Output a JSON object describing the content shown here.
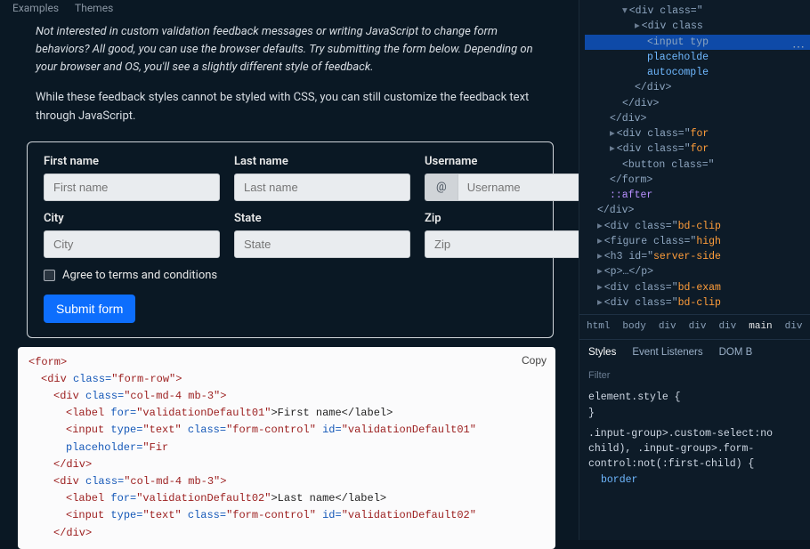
{
  "nav": {
    "examples": "Examples",
    "themes": "Themes"
  },
  "para1": "Not interested in custom validation feedback messages or writing JavaScript to change form behaviors? All good, you can use the browser defaults. Try submitting the form below. Depending on your browser and OS, you'll see a slightly different style of feedback.",
  "para2": "While these feedback styles cannot be styled with CSS, you can still customize the feedback text through JavaScript.",
  "form": {
    "first_label": "First name",
    "first_ph": "First name",
    "last_label": "Last name",
    "last_ph": "Last name",
    "user_label": "Username",
    "user_prefix": "@",
    "user_ph": "Username",
    "city_label": "City",
    "city_ph": "City",
    "state_label": "State",
    "state_ph": "State",
    "zip_label": "Zip",
    "zip_ph": "Zip",
    "terms": "Agree to terms and conditions",
    "submit": "Submit form"
  },
  "code": {
    "copy": "Copy",
    "l1a": "<form>",
    "l2a": "<div ",
    "l2b": "class=",
    "l2c": "\"form-row\"",
    "l2d": ">",
    "l3a": "<div ",
    "l3b": "class=",
    "l3c": "\"col-md-4 mb-3\"",
    "l3d": ">",
    "l4a": "<label ",
    "l4b": "for=",
    "l4c": "\"validationDefault01\"",
    "l4d": ">First name</label>",
    "l5a": "<input ",
    "l5b": "type=",
    "l5c": "\"text\"",
    "l5d": " class=",
    "l5e": "\"form-control\"",
    "l5f": " id=",
    "l5g": "\"validationDefault01\"",
    "l5h": " placeholder=",
    "l5i": "\"Fir",
    "l6a": "</div>",
    "l7a": "<div ",
    "l7b": "class=",
    "l7c": "\"col-md-4 mb-3\"",
    "l7d": ">",
    "l8a": "<label ",
    "l8b": "for=",
    "l8c": "\"validationDefault02\"",
    "l8d": ">Last name</label>",
    "l9a": "<input ",
    "l9b": "type=",
    "l9c": "\"text\"",
    "l9d": " class=",
    "l9e": "\"form-control\"",
    "l9f": " id=",
    "l9g": "\"validationDefault02\"",
    "l10a": "</div>"
  },
  "dom": {
    "d1": "<div class=\"",
    "d2": "<div class",
    "d3": "<input typ",
    "d4": "placeholde",
    "d5": "autocomple",
    "d6": "</div>",
    "d7": "</div>",
    "d8": "</div>",
    "d9a": "<div class=\"",
    "d9b": "for",
    "d10a": "<div class=\"",
    "d10b": "for",
    "d11a": "<button class=\"",
    "d12": "</form>",
    "d13": "::after",
    "d14": "</div>",
    "d15a": "<div class=\"",
    "d15b": "bd-clip",
    "d16a": "<figure class=\"",
    "d16b": "high",
    "d17a": "<h3 id=\"",
    "d17b": "server-side",
    "d18": "<p>…</p>",
    "d19a": "<div class=\"",
    "d19b": "bd-exam",
    "d20a": "<div class=\"",
    "d20b": "bd-clip"
  },
  "crumbs": [
    "html",
    "body",
    "div",
    "div",
    "div",
    "main",
    "div"
  ],
  "styles": {
    "tab1": "Styles",
    "tab2": "Event Listeners",
    "tab3": "DOM B",
    "filter": "Filter",
    "es": "element.style {",
    "esc": "}",
    "rule": ".input-group>.custom-select:no",
    "rule2": "child), .input-group>.form-",
    "rule3": "control:not(:first-child) {",
    "prop": "border"
  }
}
